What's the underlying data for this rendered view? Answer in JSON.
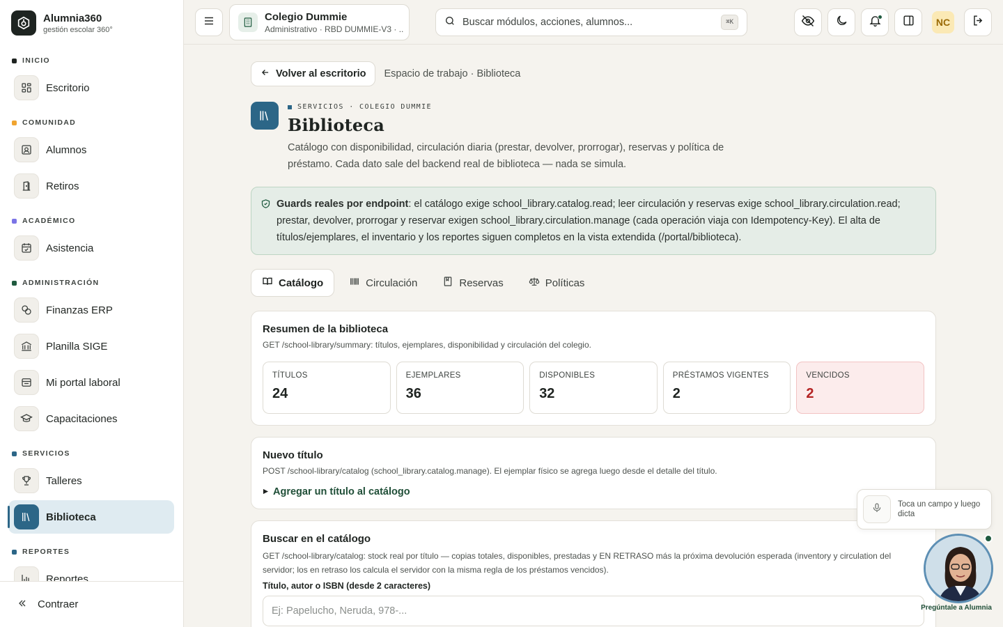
{
  "brand": {
    "name": "Alumnia360",
    "tagline": "gestión escolar 360°"
  },
  "sidebar": {
    "sections": [
      {
        "label": "INICIO",
        "color": "#1f2421",
        "items": [
          {
            "label": "Escritorio",
            "icon": "grid-icon"
          }
        ]
      },
      {
        "label": "COMUNIDAD",
        "color": "#f0a430",
        "items": [
          {
            "label": "Alumnos",
            "icon": "student-id-icon"
          },
          {
            "label": "Retiros",
            "icon": "door-exit-icon"
          }
        ]
      },
      {
        "label": "ACADÉMICO",
        "color": "#7b74e6",
        "items": [
          {
            "label": "Asistencia",
            "icon": "calendar-check-icon"
          }
        ]
      },
      {
        "label": "ADMINISTRACIÓN",
        "color": "#1f5a3f",
        "items": [
          {
            "label": "Finanzas ERP",
            "icon": "coins-icon"
          },
          {
            "label": "Planilla SIGE",
            "icon": "bank-icon"
          },
          {
            "label": "Mi portal laboral",
            "icon": "inbox-icon"
          },
          {
            "label": "Capacitaciones",
            "icon": "graduation-cap-icon"
          }
        ]
      },
      {
        "label": "SERVICIOS",
        "color": "#2c6687",
        "items": [
          {
            "label": "Talleres",
            "icon": "trophy-icon"
          },
          {
            "label": "Biblioteca",
            "icon": "library-icon",
            "active": true
          }
        ]
      },
      {
        "label": "REPORTES",
        "color": "#2c6687",
        "items": [
          {
            "label": "Reportes",
            "icon": "bar-chart-icon"
          }
        ]
      }
    ],
    "collapse_label": "Contraer"
  },
  "topbar": {
    "school_name": "Colegio Dummie",
    "school_sub": "Administrativo · RBD DUMMIE-V3 · ...",
    "search_placeholder": "Buscar módulos, acciones, alumnos...",
    "search_shortcut": "⌘K",
    "user_initials": "NC"
  },
  "main": {
    "back_label": "Volver al escritorio",
    "breadcrumb": "Espacio de trabajo · Biblioteca",
    "eyebrow": "SERVICIOS · COLEGIO DUMMIE",
    "title": "Biblioteca",
    "description": "Catálogo con disponibilidad, circulación diaria (prestar, devolver, prorrogar), reservas y política de préstamo. Cada dato sale del backend real de biblioteca — nada se simula.",
    "guard_title": "Guards reales por endpoint",
    "guard_text": ": el catálogo exige school_library.catalog.read; leer circulación y reservas exige school_library.circulation.read; prestar, devolver, prorrogar y reservar exigen school_library.circulation.manage (cada operación viaja con Idempotency-Key). El alta de títulos/ejemplares, el inventario y los reportes siguen completos en la vista extendida (/portal/biblioteca).",
    "tabs": [
      {
        "label": "Catálogo",
        "icon": "open-book-icon",
        "active": true
      },
      {
        "label": "Circulación",
        "icon": "barcode-icon"
      },
      {
        "label": "Reservas",
        "icon": "bookmark-book-icon"
      },
      {
        "label": "Políticas",
        "icon": "scale-icon"
      }
    ],
    "summary": {
      "title": "Resumen de la biblioteca",
      "subtitle": "GET /school-library/summary: títulos, ejemplares, disponibilidad y circulación del colegio.",
      "stats": [
        {
          "label": "TÍTULOS",
          "value": "24"
        },
        {
          "label": "EJEMPLARES",
          "value": "36"
        },
        {
          "label": "DISPONIBLES",
          "value": "32"
        },
        {
          "label": "PRÉSTAMOS VIGENTES",
          "value": "2"
        },
        {
          "label": "VENCIDOS",
          "value": "2",
          "danger": true
        }
      ]
    },
    "new_title": {
      "title": "Nuevo título",
      "subtitle": "POST /school-library/catalog (school_library.catalog.manage). El ejemplar físico se agrega luego desde el detalle del título.",
      "disclosure": "Agregar un título al catálogo"
    },
    "search_catalog": {
      "title": "Buscar en el catálogo",
      "subtitle": "GET /school-library/catalog: stock real por título — copias totales, disponibles, prestadas y EN RETRASO más la próxima devolución esperada (inventory y circulation del servidor; los en retraso los calcula el servidor con la misma regla de los préstamos vencidos).",
      "field_label": "Título, autor o ISBN (desde 2 caracteres)",
      "placeholder": "Ej: Papelucho, Neruda, 978-..."
    }
  },
  "assistant": {
    "dictate_hint": "Toca un campo y luego dicta",
    "label": "Pregúntale a Alumnia"
  }
}
